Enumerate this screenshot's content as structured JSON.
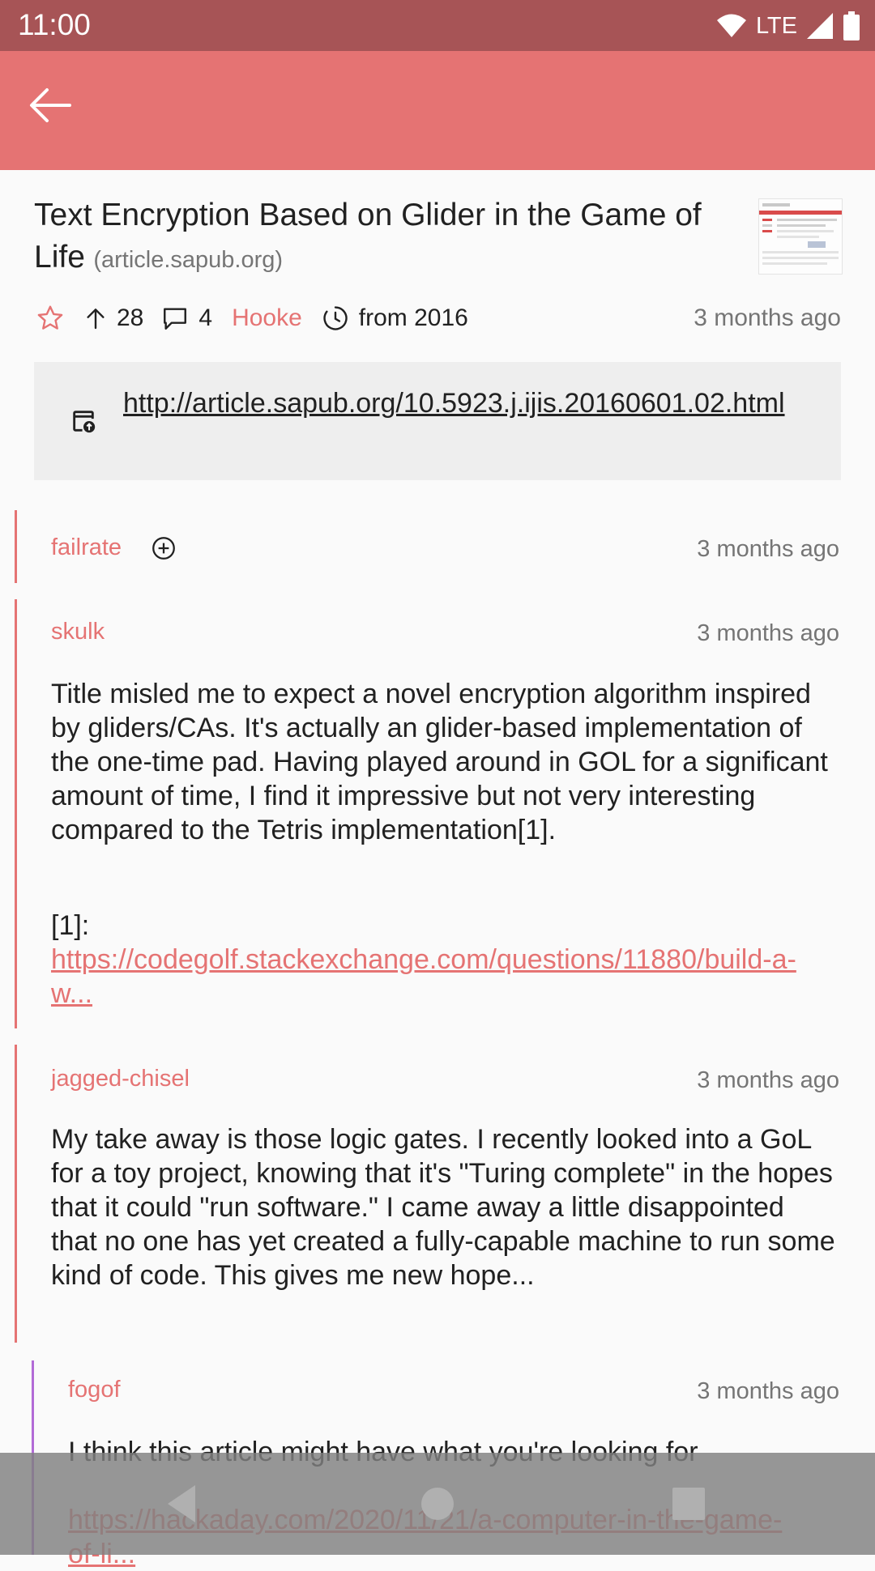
{
  "status_bar": {
    "time": "11:00",
    "network": "LTE"
  },
  "story": {
    "title": "Text Encryption Based on Glider in the Game of Life",
    "domain": "(article.sapub.org)",
    "points": "28",
    "comments": "4",
    "author": "Hooke",
    "year_label": "from 2016",
    "time": "3 months ago",
    "url": "http://article.sapub.org/10.5923.j.ijis.20160601.02.html"
  },
  "comments": [
    {
      "author": "failrate",
      "time": "3 months ago",
      "collapsed": true
    },
    {
      "author": "skulk",
      "time": "3 months ago",
      "body": "Title misled me to expect a novel encryption algorithm inspired by gliders/CAs. It's actually an glider-based implementation of the one-time pad. Having played around in GOL for a significant amount of time, I find it impressive but not very interesting compared to the Tetris implementation[1].",
      "ref_label": "[1]:",
      "ref_link": "https://codegolf.stackexchange.com/questions/11880/build-a-w..."
    },
    {
      "author": "jagged-chisel",
      "time": "3 months ago",
      "body": "My take away is those logic gates. I recently looked into a GoL for a toy project, knowing that it's \"Turing complete\" in the hopes that it could \"run software.\" I came away a little disappointed that no one has yet created a fully-capable machine to run some kind of code. This gives me new hope..."
    },
    {
      "author": "fogof",
      "time": "3 months ago",
      "body": "I think this article might have what you're looking for",
      "link": "https://hackaday.com/2020/11/21/a-computer-in-the-game-of-li..."
    }
  ],
  "colors": {
    "status_bar": "#a75456",
    "app_bar": "#e57373",
    "accent": "#e57373",
    "nested_thread": "#b26bd6"
  },
  "icons": [
    "back-arrow-icon",
    "star-icon",
    "upvote-arrow-icon",
    "comment-icon",
    "clock-icon",
    "open-link-icon",
    "expand-plus-icon",
    "wifi-icon",
    "signal-icon",
    "battery-icon"
  ]
}
